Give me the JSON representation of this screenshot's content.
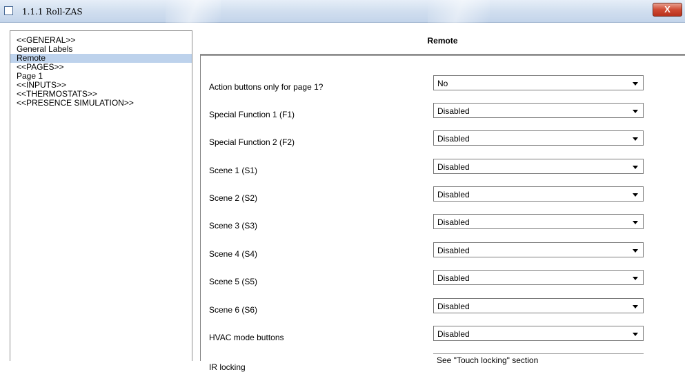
{
  "window": {
    "title": "1.1.1 Roll-ZAS",
    "close_label": "X"
  },
  "tree": {
    "items": [
      {
        "label": "<<GENERAL>>",
        "selected": false
      },
      {
        "label": "General Labels",
        "selected": false
      },
      {
        "label": "Remote",
        "selected": true
      },
      {
        "label": "<<PAGES>>",
        "selected": false
      },
      {
        "label": "Page 1",
        "selected": false
      },
      {
        "label": "<<INPUTS>>",
        "selected": false
      },
      {
        "label": "<<THERMOSTATS>>",
        "selected": false
      },
      {
        "label": "<<PRESENCE SIMULATION>>",
        "selected": false
      }
    ]
  },
  "panel": {
    "title": "Remote",
    "rows": [
      {
        "label": "Action buttons only for page 1?",
        "value": "No"
      },
      {
        "label": "Special Function 1 (F1)",
        "value": "Disabled"
      },
      {
        "label": "Special Function 2 (F2)",
        "value": "Disabled"
      },
      {
        "label": "Scene 1 (S1)",
        "value": "Disabled"
      },
      {
        "label": "Scene 2 (S2)",
        "value": "Disabled"
      },
      {
        "label": "Scene 3 (S3)",
        "value": "Disabled"
      },
      {
        "label": "Scene 4 (S4)",
        "value": "Disabled"
      },
      {
        "label": "Scene 5 (S5)",
        "value": "Disabled"
      },
      {
        "label": "Scene 6 (S6)",
        "value": "Disabled"
      },
      {
        "label": "HVAC mode buttons",
        "value": "Disabled"
      }
    ],
    "info_row": {
      "label": "IR locking",
      "value": "See \"Touch locking\" section"
    }
  }
}
